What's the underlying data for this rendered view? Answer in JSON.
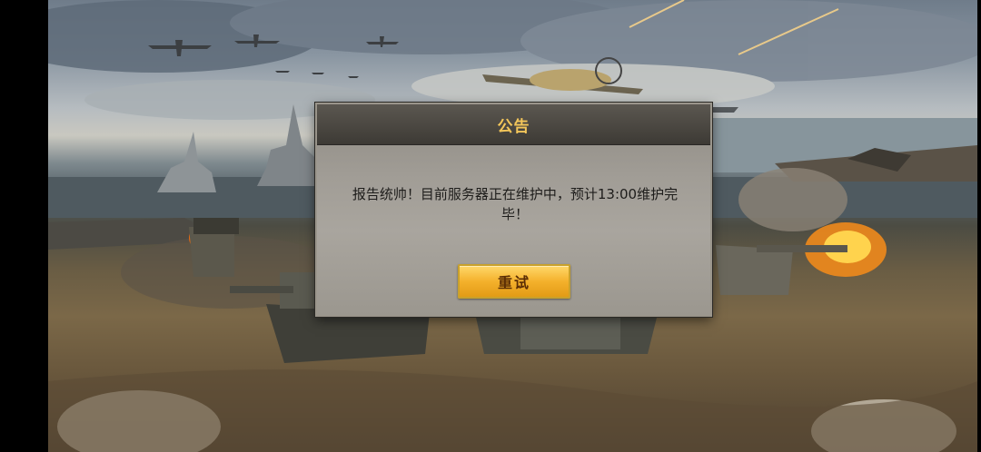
{
  "dialog": {
    "title": "公告",
    "message": "报告统帅！目前服务器正在维护中，预计13:00维护完毕！",
    "retry_label": "重试"
  },
  "colors": {
    "title_text": "#f3c65a",
    "button_gold": "#f4b12c",
    "dialog_body": "#a19d96"
  }
}
